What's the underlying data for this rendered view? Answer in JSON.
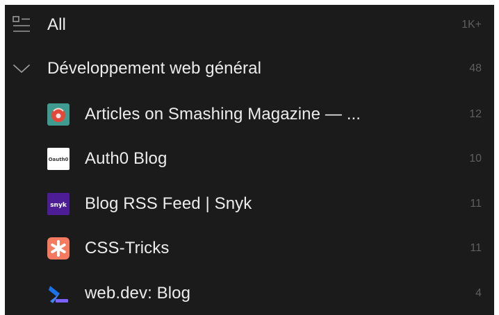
{
  "all": {
    "label": "All",
    "count": "1K+",
    "icon": "list-view-icon"
  },
  "folder": {
    "label": "Développement web général",
    "count": "48",
    "expanded": true,
    "icon": "chevron-down-icon"
  },
  "feeds": [
    {
      "label": "Articles on Smashing Magazine — ...",
      "count": "12",
      "icon": "smashing-magazine-favicon",
      "accent": "#e85d4a"
    },
    {
      "label": "Auth0 Blog",
      "count": "10",
      "icon": "auth0-favicon",
      "icon_text": "Oauth0",
      "accent": "#ffffff"
    },
    {
      "label": "Blog RSS Feed | Snyk",
      "count": "11",
      "icon": "snyk-favicon",
      "icon_text": "snyk",
      "accent": "#4c1d95"
    },
    {
      "label": "CSS-Tricks",
      "count": "11",
      "icon": "css-tricks-favicon",
      "accent": "#f47a60"
    },
    {
      "label": "web.dev: Blog",
      "count": "4",
      "icon": "web-dev-favicon",
      "accent": "#1a73e8"
    }
  ],
  "colors": {
    "background": "#1b1b1b",
    "text": "#ececec",
    "count": "#5f5f5f",
    "icon": "#9a9a9a"
  }
}
